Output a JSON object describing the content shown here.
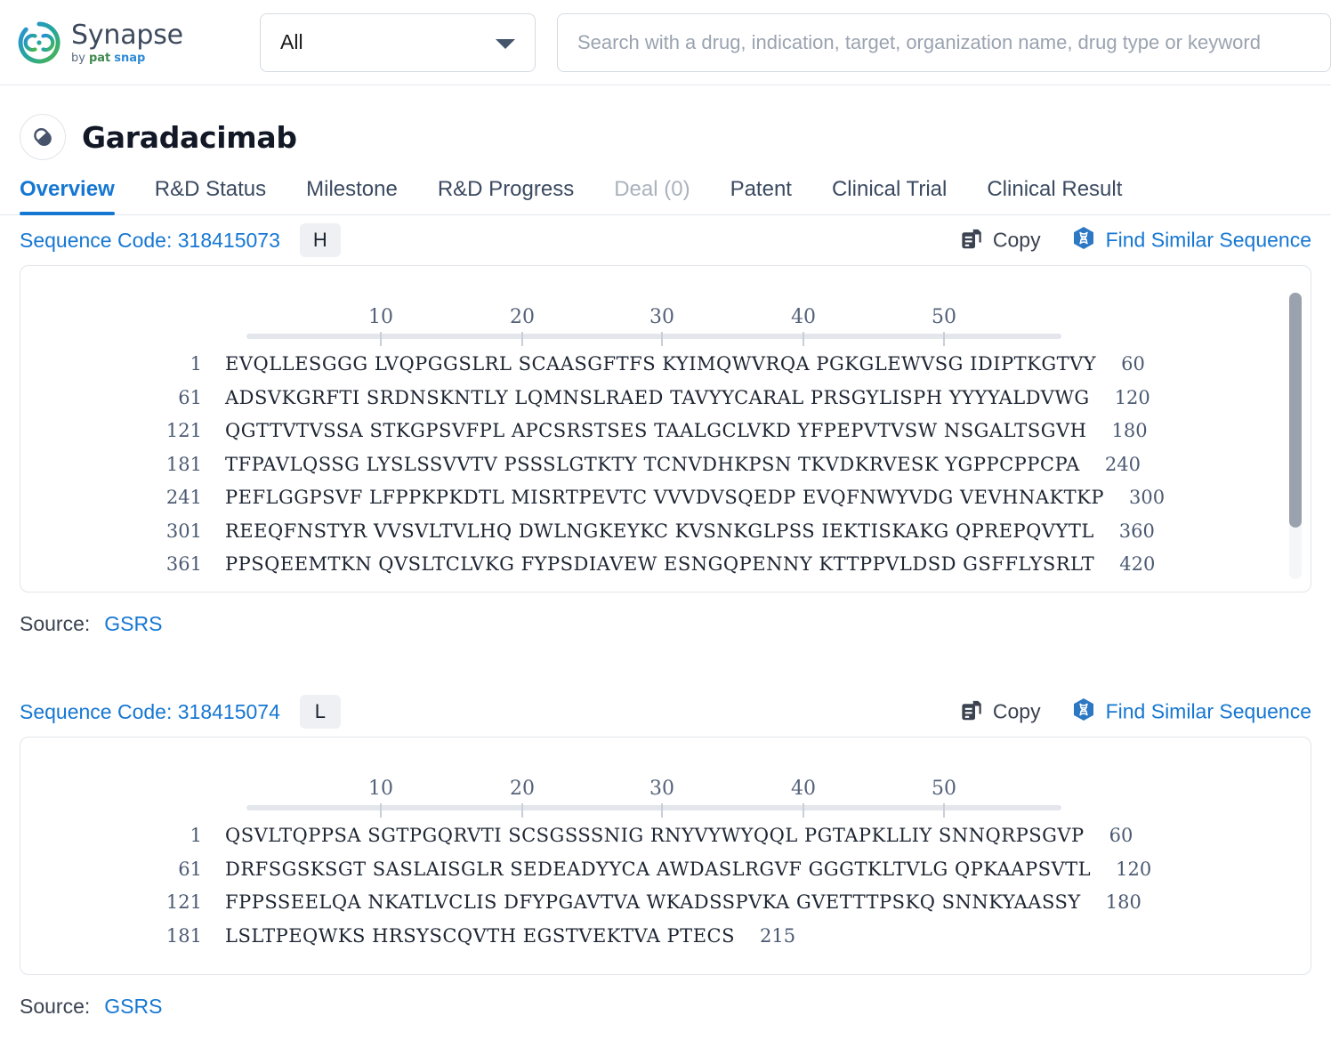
{
  "header": {
    "brand": {
      "name": "Synapse",
      "by": "by",
      "pat": "pat",
      "snap": "snap"
    },
    "scope": {
      "value": "All",
      "options": [
        "All"
      ]
    },
    "search": {
      "value": "",
      "placeholder": "Search with a drug, indication, target, organization name, drug type or keyword"
    }
  },
  "drug": {
    "title": "Garadacimab",
    "icon": "capsule-icon"
  },
  "tabs": [
    {
      "label": "Overview",
      "state": "active"
    },
    {
      "label": "R&D Status",
      "state": "normal"
    },
    {
      "label": "Milestone",
      "state": "normal"
    },
    {
      "label": "R&D Progress",
      "state": "normal"
    },
    {
      "label": "Deal (0)",
      "state": "disabled"
    },
    {
      "label": "Patent",
      "state": "normal"
    },
    {
      "label": "Clinical Trial",
      "state": "normal"
    },
    {
      "label": "Clinical Result",
      "state": "normal"
    }
  ],
  "actions": {
    "copy_label": "Copy",
    "find_similar_label": "Find Similar Sequence"
  },
  "source": {
    "label": "Source:",
    "link": "GSRS"
  },
  "ruler": {
    "ticks": [
      10,
      20,
      30,
      40,
      50
    ]
  },
  "sequences": [
    {
      "code_label": "Sequence Code: 318415073",
      "chain": "H",
      "rows": [
        {
          "start": "1",
          "body": "EVQLLESGGG LVQPGGSLRL SCAASGFTFS KYIMQWVRQA PGKGLEWVSG IDIPTKGTVY",
          "end": "60"
        },
        {
          "start": "61",
          "body": "ADSVKGRFTI SRDNSKNTLY LQMNSLRAED TAVYYCARAL PRSGYLISPH YYYYALDVWG",
          "end": "120"
        },
        {
          "start": "121",
          "body": "QGTTVTVSSA STKGPSVFPL APCSRSTSES TAALGCLVKD YFPEPVTVSW NSGALTSGVH",
          "end": "180"
        },
        {
          "start": "181",
          "body": "TFPAVLQSSG LYSLSSVVTV PSSSLGTKTY TCNVDHKPSN TKVDKRVESK YGPPCPPCPA",
          "end": "240"
        },
        {
          "start": "241",
          "body": "PEFLGGPSVF LFPPKPKDTL MISRTPEVTC VVVDVSQEDP EVQFNWYVDG VEVHNAKTKP",
          "end": "300"
        },
        {
          "start": "301",
          "body": "REEQFNSTYR VVSVLTVLHQ DWLNGKEYKC KVSNKGLPSS IEKTISKAKG QPREPQVYTL",
          "end": "360"
        },
        {
          "start": "361",
          "body": "PPSQEEMTKN QVSLTCLVKG FYPSDIAVEW ESNGQPENNY KTTPPVLDSD GSFFLYSRLT",
          "end": "420"
        }
      ]
    },
    {
      "code_label": "Sequence Code: 318415074",
      "chain": "L",
      "rows": [
        {
          "start": "1",
          "body": "QSVLTQPPSA SGTPGQRVTI SCSGSSSNIG RNYVYWYQQL PGTAPKLLIY SNNQRPSGVP",
          "end": "60"
        },
        {
          "start": "61",
          "body": "DRFSGSKSGT SASLAISGLR SEDEADYYCA AWDASLRGVF GGGTKLTVLG QPKAAPSVTL",
          "end": "120"
        },
        {
          "start": "121",
          "body": "FPPSSEELQA NKATLVCLIS DFYPGAVTVA WKADSSPVKA GVETTTPSKQ SNNKYAASSY",
          "end": "180"
        },
        {
          "start": "181",
          "body": "LSLTPEQWKS HRSYSCQVTH EGSTVEKTVA PTECS",
          "end": "215"
        }
      ]
    }
  ],
  "colors": {
    "accent_blue": "#1677d2",
    "text_dark": "#1e2633",
    "muted": "#4b5a72",
    "border": "#e1e5ea",
    "chip_bg": "#eef0f3"
  }
}
